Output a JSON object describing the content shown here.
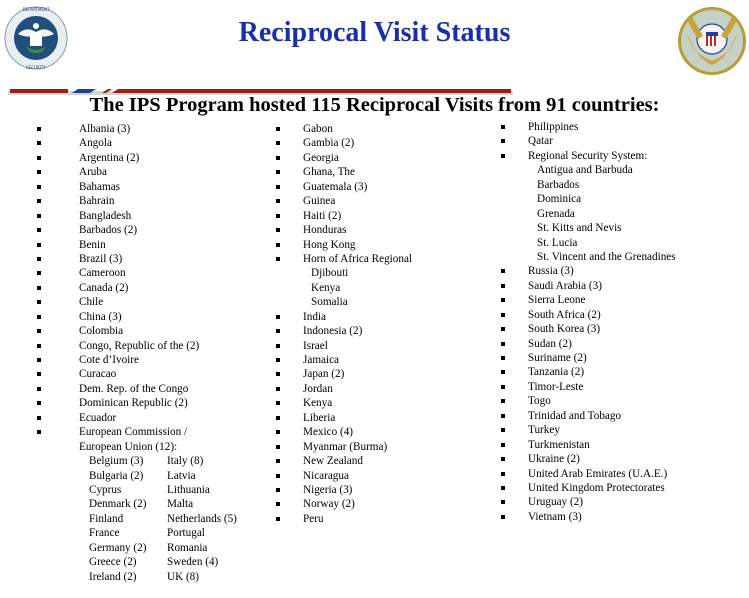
{
  "header": {
    "title": "Reciprocal Visit Status",
    "subtitle": "The IPS Program hosted 115 Reciprocal Visits from 91 countries:",
    "left_logo": "dhs-seal-icon",
    "right_logo": "uscg-seal-icon",
    "colors": {
      "title": "#1a2fa8",
      "divider_red": "#9b1c1c",
      "divider_blue": "#1f3f9a"
    }
  },
  "columns": {
    "left": {
      "items": [
        "Albania (3)",
        "Angola",
        "Argentina (2)",
        "Aruba",
        "Bahamas",
        "Bahrain",
        "Bangladesh",
        "Barbados (2)",
        "Benin",
        "Brazil (3)",
        "Cameroon",
        "Canada (2)",
        "Chile",
        "China (3)",
        "Colombia",
        "Congo, Republic of the (2)",
        "Cote d’Ivoire",
        "Curacao",
        "Dem. Rep. of the Congo",
        "Dominican Republic (2)",
        "Ecuador"
      ],
      "eu": {
        "line1": "European Commission /",
        "line2": "European Union (12):",
        "members_col1": [
          "Belgium (3)",
          "Bulgaria (2)",
          "Cyprus",
          "Denmark (2)",
          "Finland",
          "France",
          "Germany (2)",
          "Greece (2)",
          "Ireland (2)"
        ],
        "members_col2": [
          "Italy (8)",
          "Latvia",
          "Lithuania",
          "Malta",
          "Netherlands (5)",
          "Portugal",
          "Romania",
          "Sweden (4)",
          "UK  (8)"
        ]
      }
    },
    "middle": {
      "items_a": [
        "Gabon",
        "Gambia (2)",
        "Georgia",
        "Ghana, The",
        "Guatemala (3)",
        "Guinea",
        "Haiti (2)",
        "Honduras",
        "Hong Kong",
        "Horn of Africa Regional"
      ],
      "horn_of_africa": [
        "Djibouti",
        "Kenya",
        "Somalia"
      ],
      "items_b": [
        "India",
        "Indonesia (2)",
        "Israel",
        "Jamaica",
        "Japan (2)",
        "Jordan",
        "Kenya",
        "Liberia",
        "Mexico (4)",
        "Myanmar (Burma)",
        "New Zealand",
        "Nicaragua",
        "Nigeria (3)",
        "Norway (2)",
        "Peru"
      ]
    },
    "right": {
      "items_a": [
        "Philippines",
        "Qatar",
        "Regional Security System:"
      ],
      "rss_members": [
        "Antigua and Barbuda",
        "Barbados",
        "Dominica",
        "Grenada",
        "St. Kitts and Nevis",
        "St. Lucia",
        "St. Vincent and the Grenadines"
      ],
      "items_b": [
        "Russia (3)",
        "Saudi Arabia (3)",
        "Sierra Leone",
        "South Africa (2)",
        "South Korea (3)",
        "Sudan (2)",
        "Suriname (2)",
        "Tanzania (2)",
        "Timor-Leste",
        "Togo",
        "Trinidad and Tobago",
        "Turkey",
        "Turkmenistan",
        "Ukraine (2)",
        "United Arab Emirates (U.A.E.)",
        "United Kingdom Protectorates",
        "Uruguay (2)",
        "Vietnam (3)"
      ]
    }
  }
}
